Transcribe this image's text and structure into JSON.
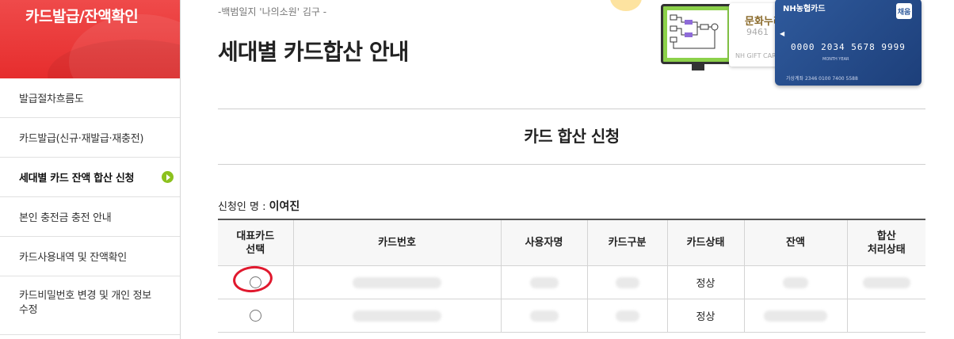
{
  "sidebar": {
    "title": "카드발급/잔액확인",
    "items": [
      {
        "label": "발급절차흐름도",
        "active": false
      },
      {
        "label": "카드발급(신규·재발급·재충전)",
        "active": false
      },
      {
        "label": "세대별 카드 잔액 합산 신청",
        "active": true
      },
      {
        "label": "본인 충전금 충전 안내",
        "active": false
      },
      {
        "label": "카드사용내역 및 잔액확인",
        "active": false
      },
      {
        "label": "카드비밀번호 변경 및 개인 정보수정",
        "active": false
      }
    ]
  },
  "header": {
    "quote": "-백범일지 '나의소원' 김구 -",
    "page_title": "세대별 카드합산 안내"
  },
  "illustration": {
    "gift_card_name": "문화누리",
    "gift_card_number": "9461",
    "gift_card_footer": "NH GIFT CARD",
    "nh_brand": "NH농협카드",
    "nh_badge": "채움",
    "nh_card_number": "0000 2034 5678 9999",
    "nh_sub": "MONTH YEAR",
    "nh_footer": "가상계좌  2346 0100 7400 5588"
  },
  "section": {
    "title": "카드 합산 신청",
    "applicant_label": "신청인 명 : ",
    "applicant_name": "이여진"
  },
  "table": {
    "headers": [
      "대표카드\n선택",
      "카드번호",
      "사용자명",
      "카드구분",
      "카드상태",
      "잔액",
      "합산\n처리상태"
    ],
    "rows": [
      {
        "status": "정상",
        "selected_marked": true
      },
      {
        "status": "정상",
        "selected_marked": false
      }
    ]
  },
  "colors": {
    "sidebar_header": "#e62d2d",
    "active_dot": "#8cc11e",
    "annotation_circle": "#e0192e"
  }
}
